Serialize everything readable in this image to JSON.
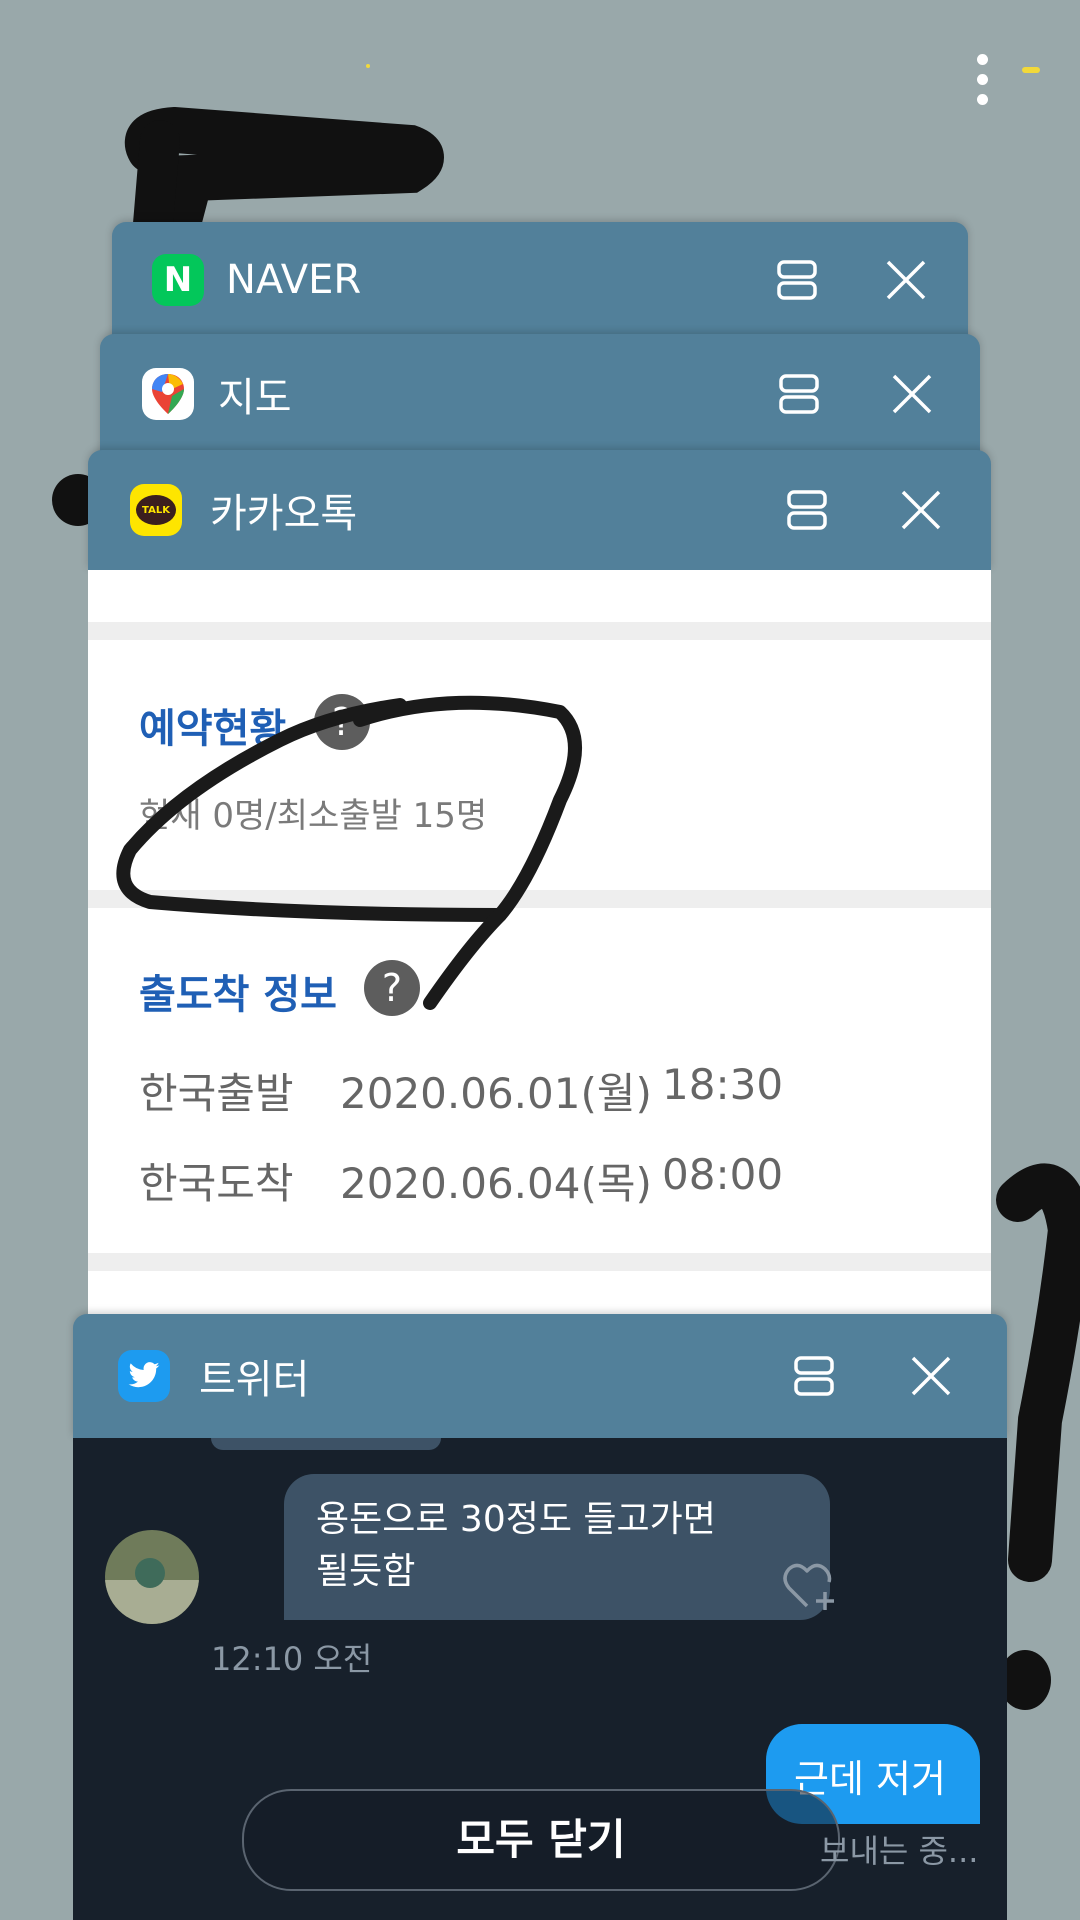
{
  "recents": {
    "windows": [
      {
        "app": "NAVER",
        "icon": "naver-icon"
      },
      {
        "app": "지도",
        "icon": "google-maps-icon"
      },
      {
        "app": "카카오톡",
        "icon": "kakaotalk-icon"
      },
      {
        "app": "트위터",
        "icon": "twitter-icon"
      }
    ],
    "close_all_label": "모두 닫기"
  },
  "kakao": {
    "icon_text": "TALK",
    "reservation_title": "예약현황",
    "reservation_status": "현재 0명/최소출발 15명",
    "departure_title": "출도착 정보",
    "rows": [
      {
        "label": "한국출발",
        "date": "2020.06.01(월)",
        "time": "18:30"
      },
      {
        "label": "한국도착",
        "date": "2020.06.04(목)",
        "time": "08:00"
      }
    ],
    "help_symbol": "?"
  },
  "twitter": {
    "message_in": "용돈으로 30정도 들고가면\n될듯함",
    "message_in_time": "12:10 오전",
    "message_out": "근데 저거",
    "sending_status": "보내는 중..."
  },
  "colors": {
    "background": "#99a8aa",
    "header": "#52809a",
    "kakao_blue": "#1f5fb5",
    "twitter_blue": "#1d9bf0",
    "twitter_bg": "#17202b",
    "drawing": "#111111"
  }
}
